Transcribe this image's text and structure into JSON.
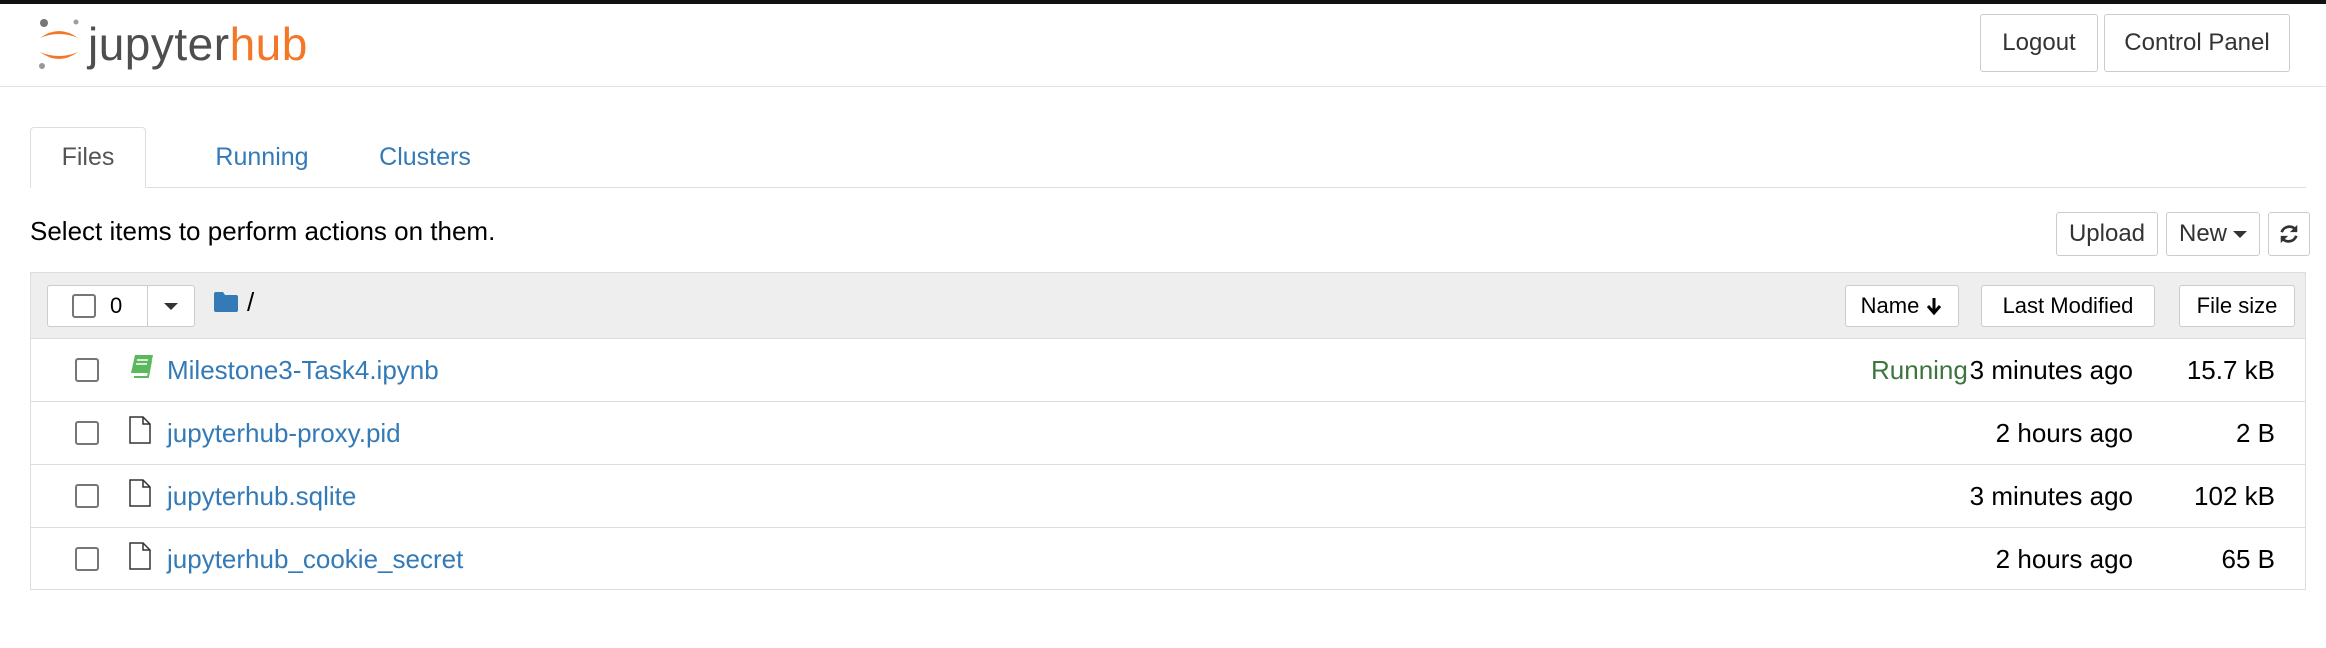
{
  "header": {
    "logo_part1": "jupyter",
    "logo_part2": "hub",
    "logout_label": "Logout",
    "control_panel_label": "Control Panel"
  },
  "tabs": [
    {
      "label": "Files",
      "active": true
    },
    {
      "label": "Running",
      "active": false
    },
    {
      "label": "Clusters",
      "active": false
    }
  ],
  "toolbar": {
    "instructions": "Select items to perform actions on them.",
    "upload_label": "Upload",
    "new_label": "New",
    "refresh_icon": "refresh-icon"
  },
  "list_header": {
    "selected_count": "0",
    "breadcrumb": "/",
    "sort_name_label": "Name",
    "sort_modified_label": "Last Modified",
    "sort_size_label": "File size"
  },
  "files": [
    {
      "name": "Milestone3-Task4.ipynb",
      "icon": "notebook-icon",
      "status": "Running",
      "modified": "3 minutes ago",
      "size": "15.7 kB"
    },
    {
      "name": "jupyterhub-proxy.pid",
      "icon": "file-icon",
      "status": "",
      "modified": "2 hours ago",
      "size": "2 B"
    },
    {
      "name": "jupyterhub.sqlite",
      "icon": "file-icon",
      "status": "",
      "modified": "3 minutes ago",
      "size": "102 kB"
    },
    {
      "name": "jupyterhub_cookie_secret",
      "icon": "file-icon",
      "status": "",
      "modified": "2 hours ago",
      "size": "65 B"
    }
  ],
  "colors": {
    "accent_orange": "#f37726",
    "link_blue": "#337ab7",
    "running_green": "#3c763d"
  }
}
